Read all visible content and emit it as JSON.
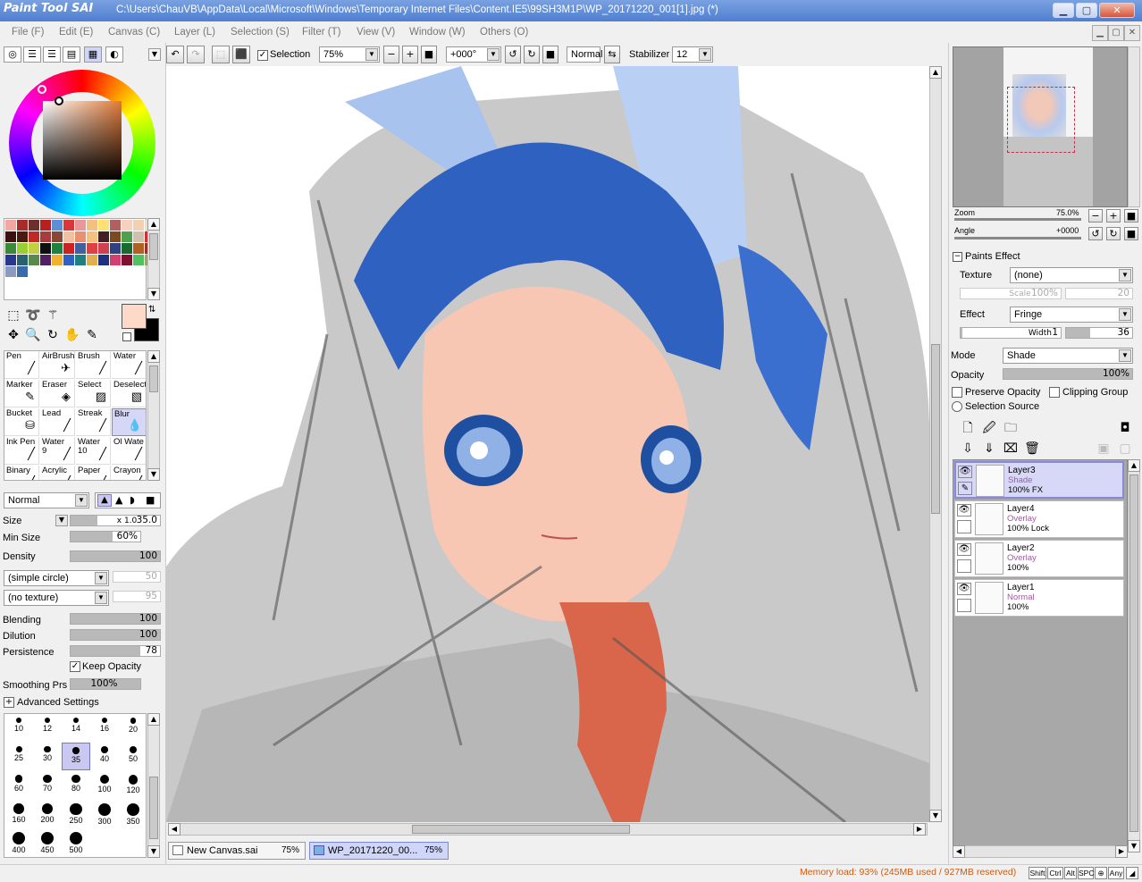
{
  "window": {
    "app_logo": "Paint Tool SAI",
    "title": "C:\\Users\\ChauVB\\AppData\\Local\\Microsoft\\Windows\\Temporary Internet Files\\Content.IE5\\99SH3M1P\\WP_20171220_001[1].jpg (*)",
    "min_label": "▁",
    "max_label": "▢",
    "close_label": "✕"
  },
  "menu": [
    "File (F)",
    "Edit (E)",
    "Canvas (C)",
    "Layer (L)",
    "Selection (S)",
    "Filter (T)",
    "View (V)",
    "Window (W)",
    "Others (O)"
  ],
  "toolbar": {
    "selection_label": "Selection",
    "zoom_value": "75%",
    "angle_value": "+000°",
    "mode_value": "Normal",
    "stabilizer_label": "Stabilizer",
    "stabilizer_value": "12"
  },
  "swatch_colors": [
    "#f4a6a0",
    "#a82a2a",
    "#6e2e2e",
    "#b82020",
    "#5b8fd6",
    "#d83838",
    "#e89898",
    "#f4c080",
    "#ffe070",
    "#b06060",
    "#f8d0c0",
    "#f4d0b0",
    "#e0e0e0",
    "#3a1010",
    "#4a1a10",
    "#c02828",
    "#a83c3c",
    "#884838",
    "#f2c0a0",
    "#e89070",
    "#f7c080",
    "#402020",
    "#7a4a20",
    "#50a050",
    "#d0c0b0",
    "#cc3333",
    "#3a8a3a",
    "#9acd32",
    "#c0d040",
    "#101010",
    "#208040",
    "#cc2222",
    "#4060a0",
    "#e04040",
    "#d04050",
    "#304080",
    "#1a6a30",
    "#b06020",
    "#9a3030",
    "#283890",
    "#2a6070",
    "#5a8a4a",
    "#502060",
    "#f0b030",
    "#3060c0",
    "#208080",
    "#e0b050",
    "#203080",
    "#d04070",
    "#801030",
    "#50c060",
    "#a0a070",
    "#8a9ac0",
    "#3a6aaa"
  ],
  "tools": {
    "primary_color": "#fcd9c8",
    "secondary_color": "#000000"
  },
  "brushes": [
    {
      "name": "Pen",
      "icon": "pen-icon"
    },
    {
      "name": "AirBrush",
      "icon": "airbrush-icon"
    },
    {
      "name": "Brush",
      "icon": "brush-icon"
    },
    {
      "name": "Water",
      "icon": "water-icon"
    },
    {
      "name": "Marker",
      "icon": "marker-icon"
    },
    {
      "name": "Eraser",
      "icon": "eraser-icon"
    },
    {
      "name": "Select",
      "icon": "select-icon"
    },
    {
      "name": "Deselect",
      "icon": "deselect-icon"
    },
    {
      "name": "Bucket",
      "icon": "bucket-icon"
    },
    {
      "name": "Lead",
      "icon": "lead-icon"
    },
    {
      "name": "Streak",
      "icon": "streak-icon"
    },
    {
      "name": "Blur",
      "icon": "blur-icon"
    },
    {
      "name": "Ink Pen",
      "icon": "inkpen-icon"
    },
    {
      "name": "Water\n9",
      "icon": "water-icon"
    },
    {
      "name": "Water\n10",
      "icon": "water-icon"
    },
    {
      "name": "Ol Wate",
      "icon": "oilwater-icon"
    },
    {
      "name": "Binary",
      "icon": "binary-icon"
    },
    {
      "name": "Acrylic",
      "icon": "acrylic-icon"
    },
    {
      "name": "Paper",
      "icon": "paper-icon"
    },
    {
      "name": "Crayon",
      "icon": "crayon-icon"
    }
  ],
  "brush_settings": {
    "blend_mode": "Normal",
    "size_label": "Size",
    "size_mult": "x 1.0",
    "size_value": "35.0",
    "minsize_label": "Min Size",
    "minsize_value": "60%",
    "density_label": "Density",
    "density_value": "100",
    "shape_value": "(simple circle)",
    "shape_num": "50",
    "texture_value": "(no texture)",
    "texture_num": "95",
    "blending_label": "Blending",
    "blending_value": "100",
    "dilution_label": "Dilution",
    "dilution_value": "100",
    "persistence_label": "Persistence",
    "persistence_value": "78",
    "keep_opacity_label": "Keep Opacity",
    "smoothing_label": "Smoothing Prs",
    "smoothing_value": "100%",
    "advanced_label": "Advanced Settings"
  },
  "brush_sizes": [
    "10",
    "12",
    "14",
    "16",
    "20",
    "25",
    "30",
    "35",
    "40",
    "50",
    "60",
    "70",
    "80",
    "100",
    "120",
    "160",
    "200",
    "250",
    "300",
    "350",
    "400",
    "450",
    "500"
  ],
  "navigator": {
    "zoom_label": "Zoom",
    "zoom_value": "75.0%",
    "angle_label": "Angle",
    "angle_value": "+0000"
  },
  "paint_effect": {
    "header": "Paints Effect",
    "texture_label": "Texture",
    "texture_value": "(none)",
    "scale_label": "Scale",
    "scale_value": "100%",
    "scale_num": "20",
    "effect_label": "Effect",
    "effect_value": "Fringe",
    "width_label": "Width",
    "width_value": "1",
    "width_num": "36"
  },
  "layer_settings": {
    "mode_label": "Mode",
    "mode_value": "Shade",
    "opacity_label": "Opacity",
    "opacity_value": "100%",
    "preserve_label": "Preserve Opacity",
    "clipping_label": "Clipping Group",
    "selsource_label": "Selection Source"
  },
  "layers": [
    {
      "name": "Layer3",
      "mode": "Shade",
      "opacity": "100% FX",
      "selected": true
    },
    {
      "name": "Layer4",
      "mode": "Overlay",
      "opacity": "100% Lock",
      "selected": false
    },
    {
      "name": "Layer2",
      "mode": "Overlay",
      "opacity": "100%",
      "selected": false
    },
    {
      "name": "Layer1",
      "mode": "Normal",
      "opacity": "100%",
      "selected": false
    }
  ],
  "tabs": [
    {
      "label": "New Canvas.sai",
      "pct": "75%"
    },
    {
      "label": "WP_20171220_00...",
      "pct": "75%"
    }
  ],
  "status": {
    "memory": "Memory load: 93% (245MB used / 927MB reserved)",
    "keys": [
      "Shift",
      "Ctrl",
      "Alt",
      "SPC",
      "⊕",
      "Any"
    ]
  }
}
